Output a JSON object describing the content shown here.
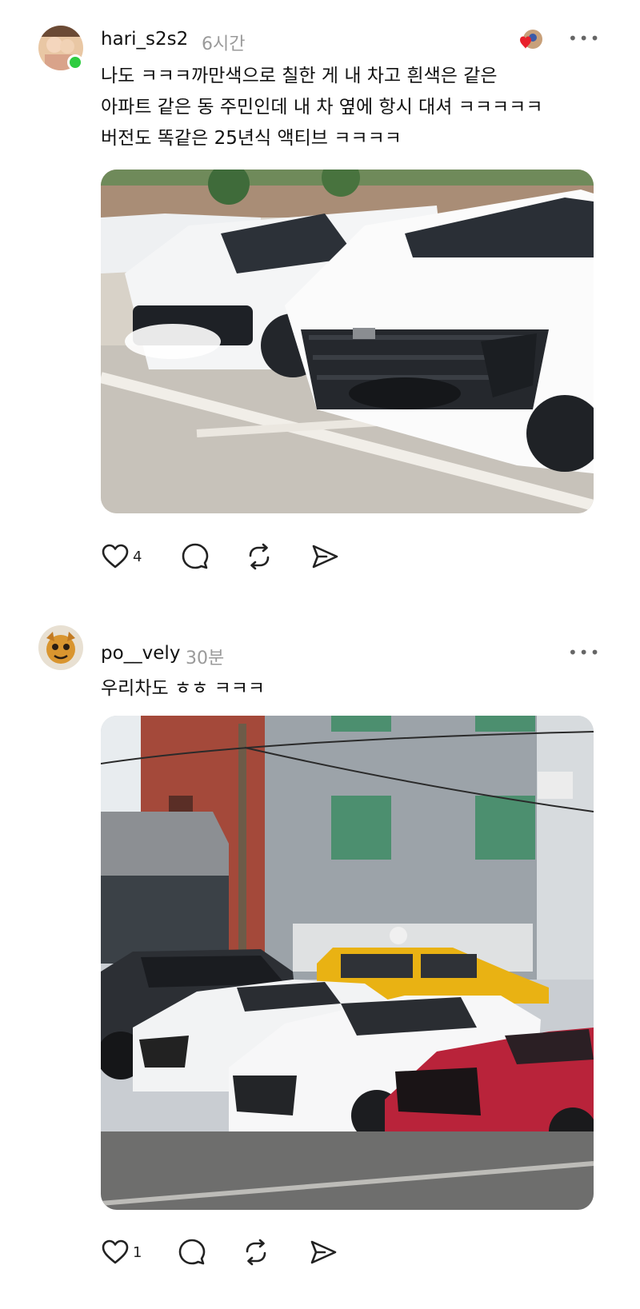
{
  "posts": [
    {
      "username": "hari_s2s2",
      "time": "6시간",
      "text": "나도 ㅋㅋㅋ까만색으로 칠한 게 내 차고 흰색은 같은\n아파트 같은 동 주민인데 내 차 옆에 항시 대셔 ㅋㅋㅋㅋㅋ\n버전도 똑같은 25년식 액티브 ㅋㅋㅋㅋ",
      "like_count": "4",
      "more_label": "•••",
      "image_icon": "two-white-suvs-photo"
    },
    {
      "username": "po__vely",
      "time": "30분",
      "text": "우리차도 ㅎㅎ ㅋㅋㅋ",
      "like_count": "1",
      "more_label": "•••",
      "image_icon": "parked-cars-photo"
    }
  ],
  "icons": [
    "heart-icon",
    "comment-icon",
    "repost-icon",
    "share-icon",
    "more-icon"
  ],
  "colors": {
    "online": "#2ecc40",
    "muted": "#9a9a9a",
    "text": "#111111"
  }
}
